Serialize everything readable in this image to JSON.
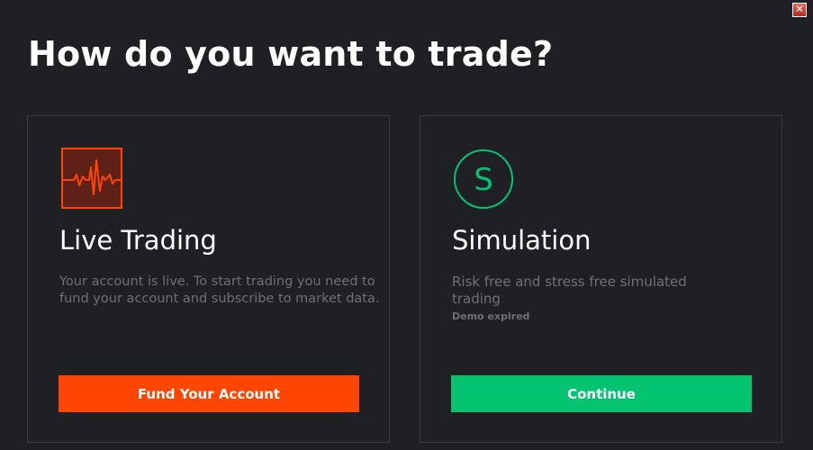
{
  "dialog": {
    "title": "How do you want to trade?",
    "close_label": "✕"
  },
  "cards": {
    "live": {
      "icon": "heartbeat-pulse-icon",
      "title": "Live Trading",
      "description": "Your account is live. To start trading you need to fund your account and subscribe to market data.",
      "button_label": "Fund Your Account",
      "accent_color": "#ff4500"
    },
    "simulation": {
      "icon": "simulation-s-icon",
      "icon_letter": "S",
      "title": "Simulation",
      "description": "Risk free and stress free simulated trading",
      "note": "Demo expired",
      "button_label": "Continue",
      "accent_color": "#04c472"
    }
  },
  "colors": {
    "background": "#1f2024",
    "card_border": "#3a3b40",
    "muted_text": "#6e7076",
    "heading_text": "#ffffff"
  }
}
